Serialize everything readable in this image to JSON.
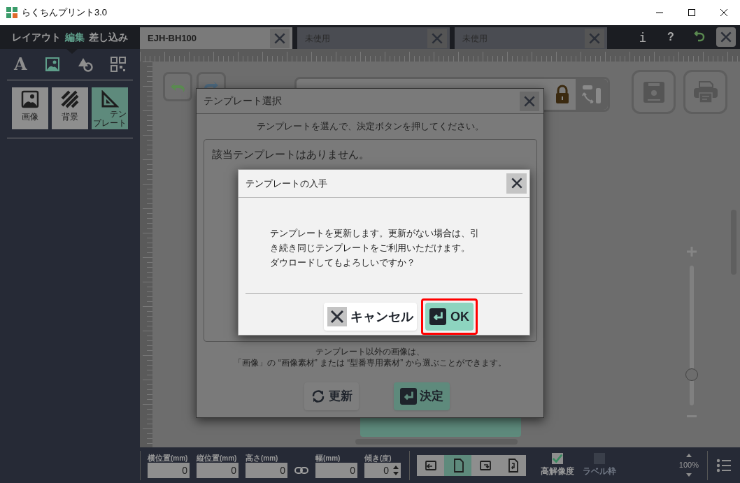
{
  "window": {
    "title": "らくちんプリント3.0"
  },
  "mode_tabs": [
    {
      "label": "レイアウト",
      "selected": false
    },
    {
      "label": "編集",
      "selected": true
    },
    {
      "label": "差し込み",
      "selected": false
    }
  ],
  "doc_tabs": [
    {
      "label": "EJH-BH100",
      "selected": true
    },
    {
      "label": "未使用",
      "selected": false
    },
    {
      "label": "未使用",
      "selected": false
    }
  ],
  "header_buttons": [
    {
      "kind": "info",
      "label": "i"
    },
    {
      "kind": "help",
      "label": "?"
    },
    {
      "kind": "back"
    },
    {
      "kind": "close"
    }
  ],
  "tool_icons": [
    {
      "kind": "text",
      "label": "A",
      "selected": false
    },
    {
      "kind": "image",
      "selected": true
    },
    {
      "kind": "shape",
      "selected": false
    },
    {
      "kind": "code",
      "selected": false
    }
  ],
  "tool_buttons": [
    {
      "kind": "image",
      "label": "画像",
      "selected": false
    },
    {
      "kind": "background",
      "label": "背景",
      "selected": false
    },
    {
      "kind": "template",
      "label": "テンプレート",
      "selected": true
    }
  ],
  "template_dialog": {
    "title": "テンプレート選択",
    "instruction": "テンプレートを選んで、決定ボタンを押してください。",
    "empty_message": "該当テンプレートはありません。",
    "note_lines": [
      "テンプレート以外の画像は、",
      "「画像」の “画像素材” または “型番専用素材” から選ぶことができます。"
    ],
    "buttons": [
      {
        "kind": "refresh",
        "label": "更新"
      },
      {
        "kind": "confirm",
        "label": "決定"
      }
    ]
  },
  "download_dialog": {
    "title": "テンプレートの入手",
    "message_paragraphs": [
      "テンプレートを更新します。更新がない場合は、引き続き同じテンプレートをご利用いただけます。",
      "ダウロードしてもよろしいですか？"
    ],
    "buttons": [
      {
        "kind": "cancel",
        "label": "キャンセル",
        "highlighted": false
      },
      {
        "kind": "ok",
        "label": "OK",
        "highlighted": true
      }
    ]
  },
  "zoom_slider": {
    "level": 0.22
  },
  "properties": [
    {
      "label": "横位置",
      "unit": "(mm)",
      "value": "0",
      "kind": "field"
    },
    {
      "label": "縦位置",
      "unit": "(mm)",
      "value": "0",
      "kind": "field"
    },
    {
      "label": "高さ",
      "unit": "(mm)",
      "value": "0",
      "kind": "field"
    },
    {
      "label": "幅",
      "unit": "(mm)",
      "value": "0",
      "kind": "field"
    },
    {
      "label": "傾き",
      "unit": "(度)",
      "value": "0",
      "kind": "spinner"
    }
  ],
  "orientation": [
    {
      "kind": "rotate-left",
      "selected": false
    },
    {
      "kind": "portrait",
      "selected": true
    },
    {
      "kind": "rotate-right",
      "selected": false
    },
    {
      "kind": "flip",
      "selected": false
    }
  ],
  "print_options": [
    {
      "label": "高解像度",
      "checked": true,
      "disabled": false
    },
    {
      "label": "ラベル枠",
      "checked": false,
      "disabled": true
    }
  ],
  "zoom_level": "100%"
}
